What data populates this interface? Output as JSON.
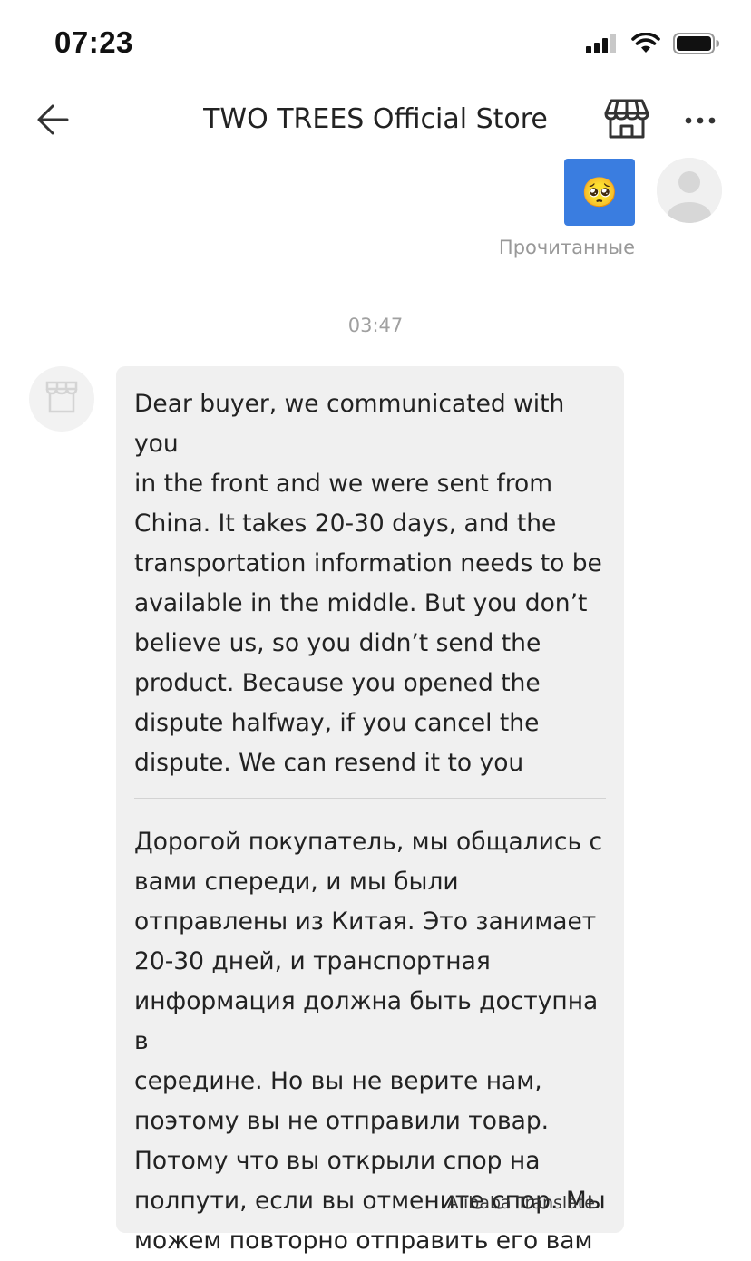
{
  "status_bar": {
    "time": "07:23"
  },
  "header": {
    "title": "TWO TREES Official Store",
    "back_icon": "arrow-left-icon",
    "store_icon": "storefront-icon",
    "more_icon": "more-horizontal-icon"
  },
  "chat": {
    "sent_message": {
      "emoji": "🥺",
      "read_status": "Прочитанные"
    },
    "timestamp": "03:47",
    "received_message": {
      "original_text": "Dear buyer, we communicated with you\nin the front and we were sent from\nChina. It takes 20-30 days, and the\ntransportation information needs to be\navailable in the middle. But you don’t\nbelieve us, so you didn’t send the\nproduct. Because you opened the\ndispute halfway, if you cancel the\ndispute. We can resend it to you",
      "translated_text": "Дорогой покупатель, мы общались с\nвами спереди, и мы были\nотправлены из Китая. Это занимает\n20-30 дней, и транспортная\nинформация должна быть доступна в\nсередине. Но вы не верите нам,\nпоэтому вы не отправили товар.\nПотому что вы открыли спор на\nполпути, если вы отмените спор. Мы\nможем повторно отправить его вам",
      "translator": "Alibaba Translate"
    }
  },
  "colors": {
    "sent_bubble": "#3a7de0",
    "received_bubble": "#f0f0f0",
    "muted_text": "#999999"
  }
}
